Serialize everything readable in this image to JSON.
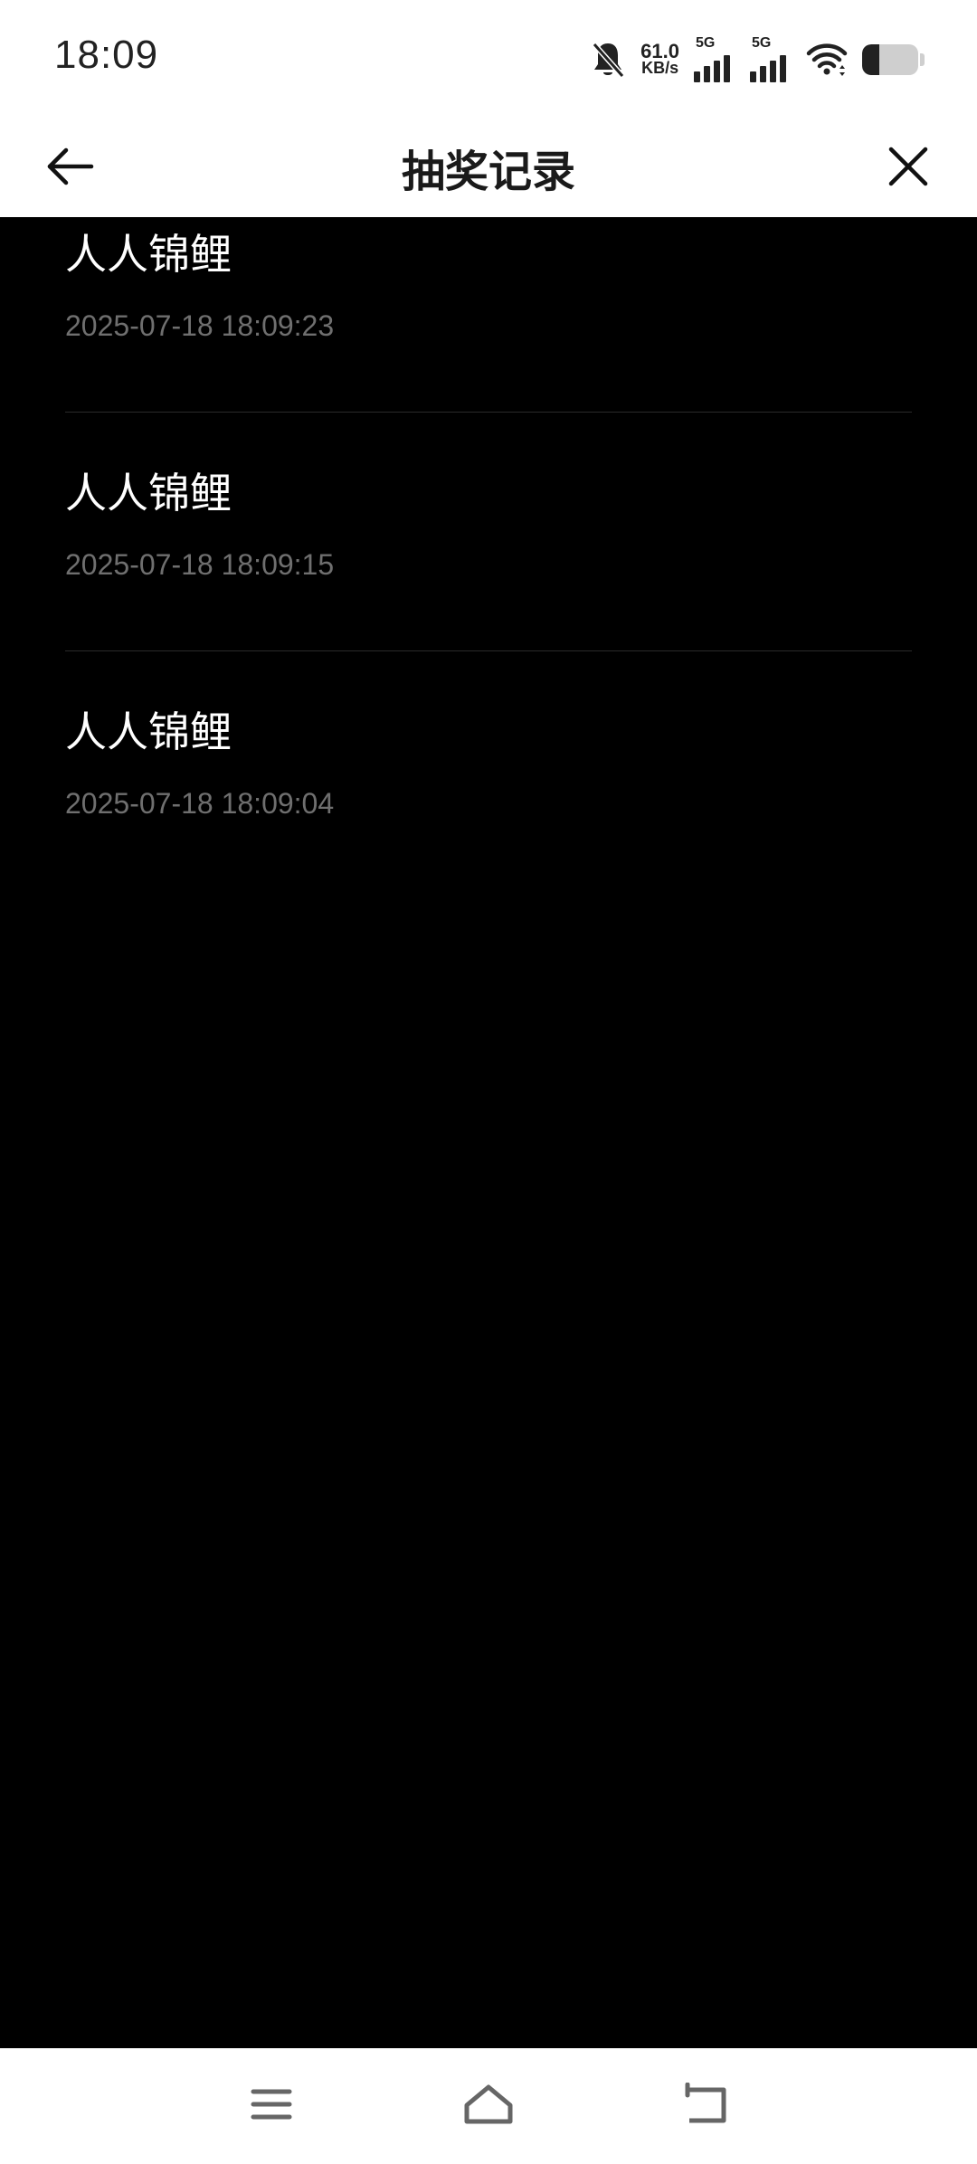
{
  "status_bar": {
    "time": "18:09",
    "net_speed_value": "61.0",
    "net_speed_unit": "KB/s",
    "sim1_type": "5G",
    "sim2_type": "5G",
    "icons": [
      "bell-muted-icon",
      "signal-icon",
      "signal-icon",
      "wifi-icon",
      "battery-icon"
    ],
    "battery_level": 0.3
  },
  "header": {
    "title": "抽奖记录",
    "back_icon": "arrow-left-icon",
    "close_icon": "close-icon"
  },
  "records": [
    {
      "name": "人人锦鲤",
      "time": "2025-07-18 18:09:23"
    },
    {
      "name": "人人锦鲤",
      "time": "2025-07-18 18:09:15"
    },
    {
      "name": "人人锦鲤",
      "time": "2025-07-18 18:09:04"
    }
  ],
  "nav_bar": {
    "icons": [
      "menu-icon",
      "home-icon",
      "back-icon"
    ]
  },
  "colors": {
    "background": "#000000",
    "bar_background": "#ffffff",
    "record_name": "#ffffff",
    "record_time": "#6f6f6f",
    "divider": "#2a2a2a"
  }
}
